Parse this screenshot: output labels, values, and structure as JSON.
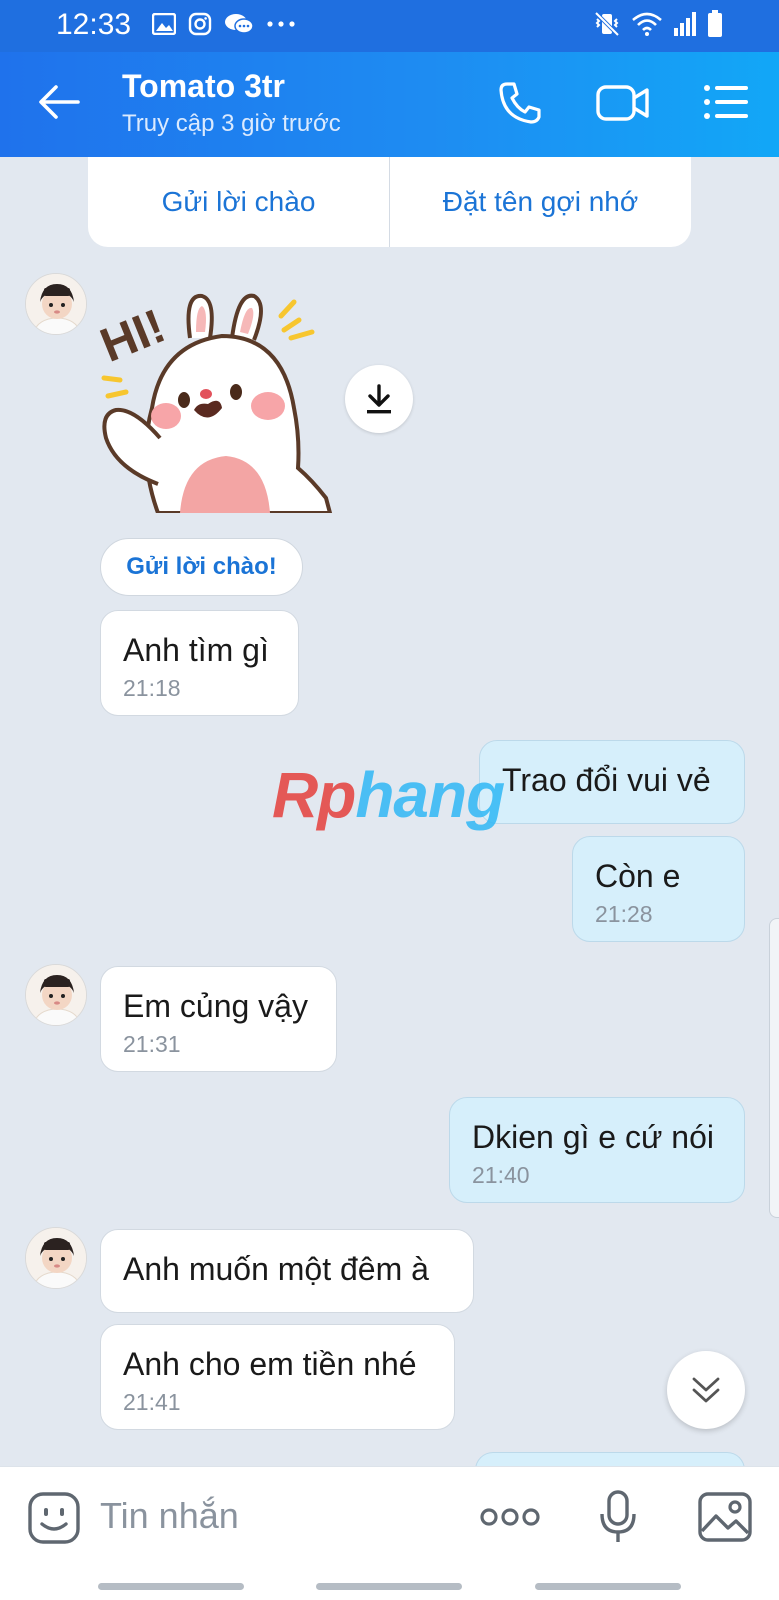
{
  "status_bar": {
    "time": "12:33",
    "left_icons": [
      "image-icon",
      "instagram-icon",
      "messenger-icon",
      "more-dots-icon"
    ],
    "right_icons": [
      "mute-vibrate-icon",
      "wifi-icon",
      "signal-icon",
      "battery-icon"
    ]
  },
  "header": {
    "title": "Tomato 3tr",
    "subtitle": "Truy cập 3 giờ trước",
    "icons": [
      "back-arrow-icon",
      "phone-icon",
      "video-call-icon",
      "menu-list-icon"
    ]
  },
  "actions": {
    "greet_label": "Gửi lời chào",
    "nickname_label": "Đặt tên gợi nhớ"
  },
  "sticker": {
    "text": "HI!",
    "download_icon": "download-icon"
  },
  "greeting_pill": "Gửi lời chào!",
  "messages": [
    {
      "side": "in",
      "text": "Anh tìm gì",
      "time": "21:18"
    },
    {
      "side": "out",
      "text": "Trao đổi vui vẻ",
      "time": ""
    },
    {
      "side": "out",
      "text": "Còn e",
      "time": "21:28"
    },
    {
      "side": "in",
      "text": "Em củng vậy",
      "time": "21:31"
    },
    {
      "side": "out",
      "text": "Dkien gì e cứ nói",
      "time": "21:40"
    },
    {
      "side": "in",
      "text": "Anh muốn một đêm à",
      "time": ""
    },
    {
      "side": "in",
      "text": "Anh cho em tiền nhé",
      "time": "21:41"
    }
  ],
  "watermark": {
    "part1": "Rp",
    "part2": "hang"
  },
  "composer": {
    "placeholder": "Tin nhắn",
    "icons": [
      "emoji-icon",
      "more-options-icon",
      "microphone-icon",
      "image-gallery-icon"
    ]
  },
  "colors": {
    "header_start": "#1f72ec",
    "header_end": "#12a7f7",
    "chat_background": "#e2e8f0",
    "outgoing_bubble": "#d6effb",
    "incoming_bubble": "#ffffff",
    "accent_text": "#1b74d6"
  }
}
